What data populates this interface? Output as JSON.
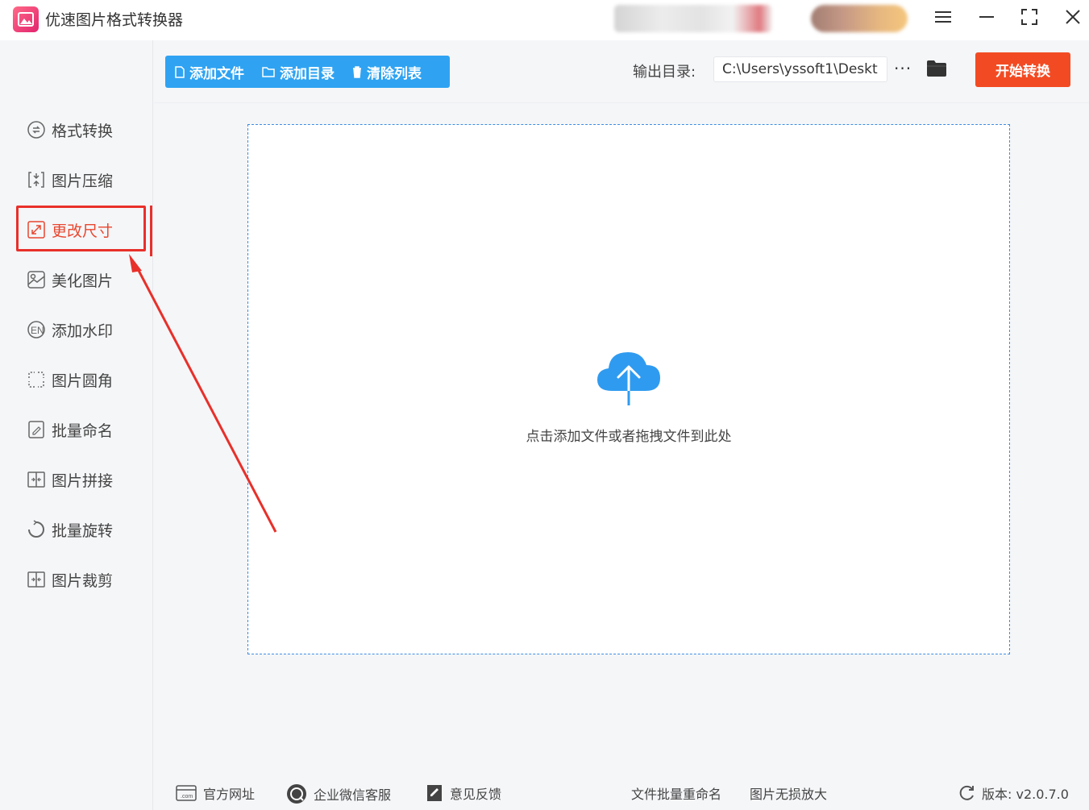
{
  "app": {
    "title": "优速图片格式转换器"
  },
  "sidebar": {
    "items": [
      {
        "label": "格式转换",
        "icon": "format-convert-icon"
      },
      {
        "label": "图片压缩",
        "icon": "compress-icon"
      },
      {
        "label": "更改尺寸",
        "icon": "resize-icon",
        "active": true
      },
      {
        "label": "美化图片",
        "icon": "beautify-icon"
      },
      {
        "label": "添加水印",
        "icon": "watermark-icon"
      },
      {
        "label": "图片圆角",
        "icon": "rounded-corner-icon"
      },
      {
        "label": "批量命名",
        "icon": "rename-icon"
      },
      {
        "label": "图片拼接",
        "icon": "stitch-icon"
      },
      {
        "label": "批量旋转",
        "icon": "rotate-icon"
      },
      {
        "label": "图片裁剪",
        "icon": "crop-icon"
      }
    ]
  },
  "toolbar": {
    "add_file": "添加文件",
    "add_dir": "添加目录",
    "clear_list": "清除列表",
    "output_label": "输出目录:",
    "output_path": "C:\\Users\\yssoft1\\Deskt",
    "more": "···",
    "start": "开始转换"
  },
  "dropzone": {
    "hint": "点击添加文件或者拖拽文件到此处"
  },
  "footer": {
    "website": "官方网址",
    "wechat": "企业微信客服",
    "feedback": "意见反馈",
    "batch_rename": "文件批量重命名",
    "enlarge": "图片无损放大",
    "version": "版本: v2.0.7.0"
  },
  "colors": {
    "accent": "#2fa3f2",
    "start": "#f24b23",
    "highlight": "#e8302a",
    "dropzone_border": "#3b8de4"
  }
}
